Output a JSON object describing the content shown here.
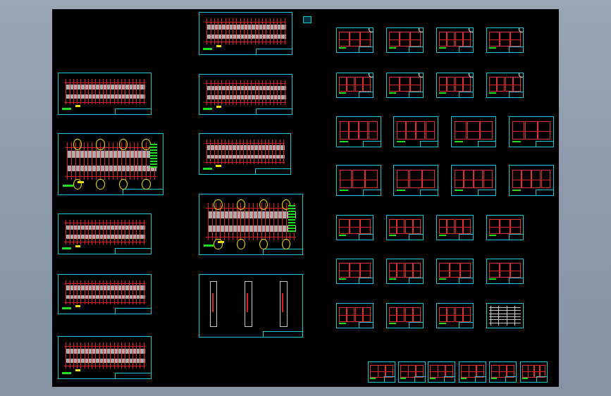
{
  "window": {
    "title": ""
  },
  "colors": {
    "background": "#8e9aab",
    "canvas": "#000000",
    "frame": "#18c8d8",
    "line_red": "#e02020",
    "highlight_gray": "#c9c9c9",
    "annotation_yellow": "#f2e000",
    "annotation_green": "#1ee01e"
  },
  "icons": {
    "ucs": "ucs-icon"
  },
  "drawing": {
    "sheet_kinds": [
      "long-elevation",
      "plan-with-circles",
      "column-panel",
      "detail-grid",
      "small-detail",
      "table"
    ],
    "sheets": [
      {
        "id": "s1",
        "kind": "long-elevation"
      },
      {
        "id": "s2",
        "kind": "plan-with-circles"
      },
      {
        "id": "s3",
        "kind": "long-elevation"
      },
      {
        "id": "s4",
        "kind": "long-elevation"
      },
      {
        "id": "s5",
        "kind": "long-elevation"
      },
      {
        "id": "m1",
        "kind": "long-elevation"
      },
      {
        "id": "m2",
        "kind": "long-elevation"
      },
      {
        "id": "m3",
        "kind": "long-elevation"
      },
      {
        "id": "m4",
        "kind": "plan-with-circles"
      },
      {
        "id": "m5",
        "kind": "column-panel"
      }
    ],
    "detail_grid_rows": 7,
    "detail_grid_cols": 4,
    "table_sheet_present": true,
    "bottom_strip_count": 6
  }
}
